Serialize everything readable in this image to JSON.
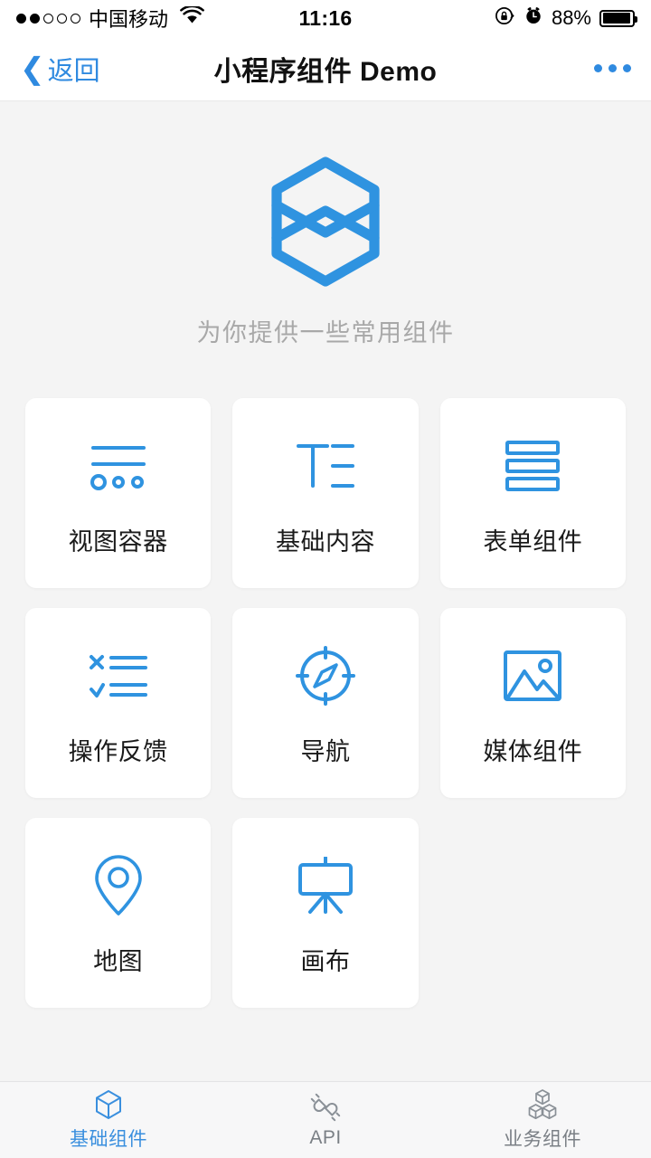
{
  "status_bar": {
    "signal_dots_total": 5,
    "signal_dots_filled": 2,
    "carrier": "中国移动",
    "wifi_icon": "wifi-icon",
    "time": "11:16",
    "rotation_lock_icon": "rotation-lock-icon",
    "alarm_icon": "alarm-clock-icon",
    "battery_percent": "88%",
    "battery_level": 88
  },
  "nav_bar": {
    "back_label": "返回",
    "back_chevron_icon": "chevron-left-icon",
    "title": "小程序组件 Demo",
    "more_icon": "more-dots-icon"
  },
  "hero": {
    "logo_icon": "hexagon-logo-icon",
    "subtitle": "为你提供一些常用组件"
  },
  "grid": {
    "items": [
      {
        "label": "视图容器",
        "icon": "view-container-icon"
      },
      {
        "label": "基础内容",
        "icon": "basic-content-icon"
      },
      {
        "label": "表单组件",
        "icon": "form-component-icon"
      },
      {
        "label": "操作反馈",
        "icon": "action-feedback-icon"
      },
      {
        "label": "导航",
        "icon": "compass-navigation-icon"
      },
      {
        "label": "媒体组件",
        "icon": "media-image-icon"
      },
      {
        "label": "地图",
        "icon": "map-pin-icon"
      },
      {
        "label": "画布",
        "icon": "canvas-easel-icon"
      }
    ]
  },
  "tab_bar": {
    "tabs": [
      {
        "label": "基础组件",
        "icon": "cube-icon",
        "active": true
      },
      {
        "label": "API",
        "icon": "plug-connector-icon",
        "active": false
      },
      {
        "label": "业务组件",
        "icon": "cubes-stack-icon",
        "active": false
      }
    ]
  },
  "colors": {
    "accent": "#2f8ae0",
    "icon_blue": "#3296e0",
    "page_bg": "#f4f4f4",
    "card_bg": "#ffffff",
    "subtitle_gray": "#a8a8a8",
    "tab_inactive": "#7a7f85",
    "tab_active": "#3a8fde"
  }
}
